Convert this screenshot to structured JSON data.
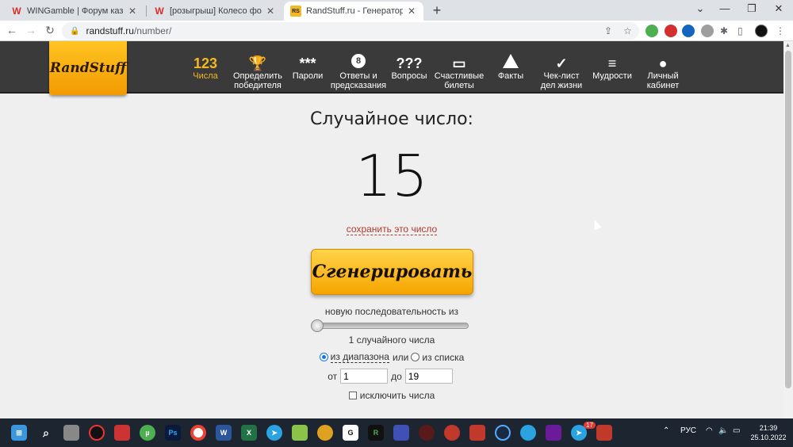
{
  "browser": {
    "tabs": [
      {
        "title": "WINGamble | Форум казино, по:",
        "icon": "wingamble-icon",
        "active": false
      },
      {
        "title": "[розыгрыш] Колесо фортуны W",
        "icon": "wingamble-icon",
        "active": false
      },
      {
        "title": "RandStuff.ru - Генератор случай",
        "icon": "randstuff-icon",
        "active": true
      }
    ],
    "new_tab": "+",
    "window_controls": {
      "minimize": "—",
      "restore": "❐",
      "close": "✕",
      "tabs_menu": "⌄"
    },
    "url_host": "randstuff.ru",
    "url_path": "/number/"
  },
  "site": {
    "logo": "RandStuff",
    "menu": [
      {
        "icon_text": "123",
        "label": "Числа",
        "active": true,
        "icon": "numbers-icon"
      },
      {
        "icon_text": "🏆",
        "label": "Определить\nпобедителя",
        "active": false,
        "icon": "trophy-icon"
      },
      {
        "icon_text": "***",
        "label": "Пароли",
        "active": false,
        "icon": "password-icon"
      },
      {
        "icon_text": "8",
        "label": "Ответы и\nпредсказания",
        "active": false,
        "icon": "eight-ball-icon"
      },
      {
        "icon_text": "???",
        "label": "Вопросы",
        "active": false,
        "icon": "questions-icon"
      },
      {
        "icon_text": "▭",
        "label": "Счастливые\nбилеты",
        "active": false,
        "icon": "ticket-icon"
      },
      {
        "icon_text": "!",
        "label": "Факты",
        "active": false,
        "icon": "facts-icon"
      },
      {
        "icon_text": "✓",
        "label": "Чек-лист\nдел жизни",
        "active": false,
        "icon": "checklist-icon"
      },
      {
        "icon_text": "≡",
        "label": "Мудрости",
        "active": false,
        "icon": "wisdom-icon"
      },
      {
        "icon_text": "●",
        "label": "Личный\nкабинет",
        "active": false,
        "icon": "user-icon"
      }
    ]
  },
  "main": {
    "heading": "Случайное число:",
    "number": "15",
    "save_link": "сохранить это число",
    "generate_button": "Сгенерировать",
    "sequence_label": "новую последовательность из",
    "count_label": "1 случайного числа",
    "radio_range": "из диапазона",
    "radio_or": "или",
    "radio_list": "из списка",
    "from_label": "от",
    "from_value": "1",
    "to_label": "до",
    "to_value": "19",
    "exclude_label": "исключить числа"
  },
  "taskbar": {
    "language": "РУС",
    "time": "21:39",
    "date": "25.10.2022",
    "telegram_badge": "17"
  }
}
